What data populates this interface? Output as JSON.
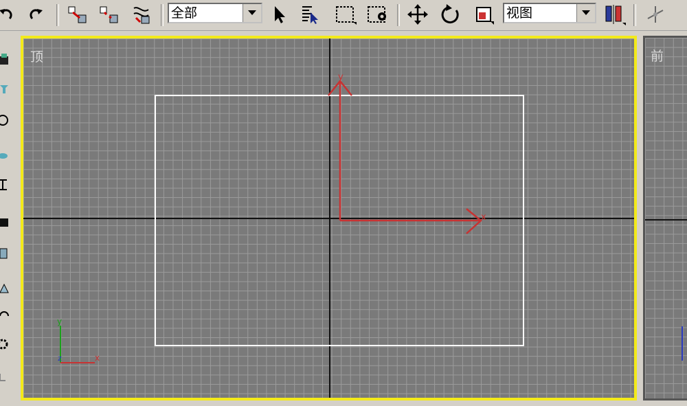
{
  "toolbar": {
    "selection_filter": {
      "value": "全部"
    },
    "reference_coord": {
      "value": "视图"
    }
  },
  "viewports": {
    "top": {
      "label": "顶"
    },
    "front": {
      "label": "前"
    }
  },
  "gizmo": {
    "x_label": "x",
    "y_label": "y"
  },
  "axis_tripod": {
    "x": "x",
    "y": "y",
    "z": "z"
  },
  "colors": {
    "active_viewport_border": "#f3ea1a",
    "grid_background": "#7a7a7a",
    "grid_lines": "#9c9c9c",
    "gizmo": "#c83232",
    "object_outline": "#ffffff"
  },
  "icons": [
    "undo-icon",
    "redo-icon",
    "select-link-icon",
    "unlink-icon",
    "bind-space-warp-icon",
    "select-object-icon",
    "select-by-name-icon",
    "rectangular-selection-icon",
    "window-crossing-icon",
    "move-icon",
    "rotate-icon",
    "scale-icon",
    "mirror-icon",
    "axis-constraint-icon"
  ]
}
